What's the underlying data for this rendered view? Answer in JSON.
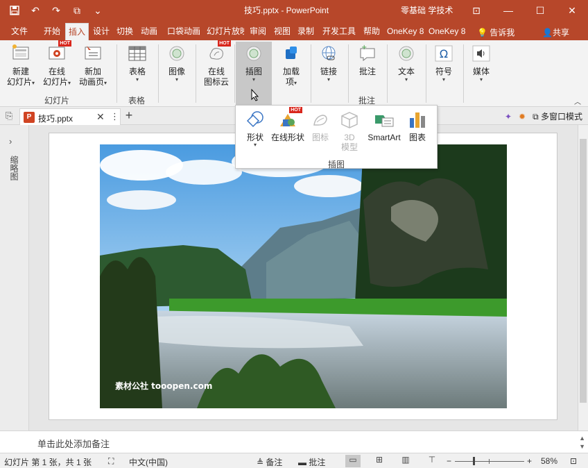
{
  "title_bar": {
    "doc_title": "技巧.pptx - PowerPoint",
    "user": "零基础 学技术"
  },
  "tabs": [
    "文件",
    "开始",
    "插入",
    "设计",
    "切换",
    "动画",
    "口袋动画",
    "幻灯片放映",
    "审阅",
    "视图",
    "录制",
    "开发工具",
    "帮助",
    "OneKey 8",
    "OneKey 8"
  ],
  "tell_me": "告诉我",
  "share": "共享",
  "ribbon": {
    "slides": {
      "new_slide": [
        "新建",
        "幻灯片"
      ],
      "online_slide": [
        "在线",
        "幻灯片"
      ],
      "new_anim_page": [
        "新加",
        "动画页"
      ],
      "group": "幻灯片"
    },
    "tables": {
      "table": "表格",
      "group": "表格"
    },
    "image": "图像",
    "online_icons": [
      "在线",
      "图标云"
    ],
    "illustrations": "插图",
    "addins": [
      "加载",
      "项"
    ],
    "links": "链接",
    "comments": {
      "comment": "批注",
      "group": "批注"
    },
    "text": "文本",
    "symbols": "符号",
    "media": "媒体",
    "hot": "HOT"
  },
  "dropdown": {
    "items": [
      "形状",
      "在线形状",
      "图标",
      "3D",
      "模型",
      "SmartArt",
      "图表"
    ],
    "label": "插图"
  },
  "doc_tab": {
    "name": "技巧.pptx",
    "multi_window": "多窗口模式"
  },
  "left_pane_label": "缩略图",
  "photo_watermark": "素材公社 tooopen.com",
  "notes_placeholder": "单击此处添加备注",
  "status": {
    "slide_info": "幻灯片 第 1 张，共 1 张",
    "language": "中文(中国)",
    "notes": "备注",
    "comments": "批注",
    "zoom": "58%"
  },
  "colors": {
    "accent": "#b7472a",
    "ribbon_bg": "#f3f3f3"
  }
}
